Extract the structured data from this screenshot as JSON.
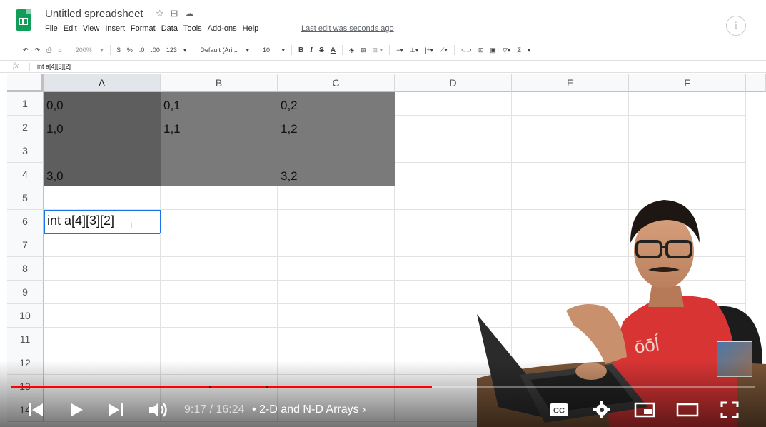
{
  "app": {
    "title": "Untitled spreadsheet",
    "title_icons": [
      "star-icon",
      "move-to-folder-icon",
      "cloud-status-icon"
    ],
    "menu": [
      "File",
      "Edit",
      "View",
      "Insert",
      "Format",
      "Data",
      "Tools",
      "Add-ons",
      "Help"
    ],
    "last_edit": "Last edit was seconds ago",
    "info_label": "i"
  },
  "toolbar": {
    "undo": "↶",
    "redo": "↷",
    "print": "⎙",
    "paint_format": "⌂",
    "zoom": "200%",
    "currency": "$",
    "percent": "%",
    "dec_decrease": ".0",
    "dec_increase": ".00",
    "more_formats": "123",
    "font": "Default (Ari...",
    "font_size": "10",
    "bold": "B",
    "italic": "I",
    "strike": "S",
    "text_color": "A",
    "sum": "Σ"
  },
  "formula_bar": {
    "fx": "fx",
    "value": "int a[4][3][2]"
  },
  "sheet": {
    "columns": [
      "A",
      "B",
      "C",
      "D",
      "E",
      "F"
    ],
    "selected_column": "A",
    "rows": [
      "1",
      "2",
      "3",
      "4",
      "5",
      "6",
      "7",
      "8",
      "9",
      "10",
      "11",
      "12",
      "13",
      "14"
    ],
    "cells": [
      [
        "0,0",
        "0,1",
        "0,2",
        "",
        "",
        ""
      ],
      [
        "1,0",
        "1,1",
        "1,2",
        "",
        "",
        ""
      ],
      [
        "",
        "",
        "",
        "",
        "",
        ""
      ],
      [
        "3,0",
        "",
        "3,2",
        "",
        "",
        ""
      ],
      [
        "",
        "",
        "",
        "",
        "",
        ""
      ],
      [
        "int a[4][3][2]",
        "",
        "",
        "",
        "",
        ""
      ]
    ],
    "active_cell": "A6"
  },
  "video": {
    "time": "9:17 / 16:24",
    "separator": "•",
    "chapter": "2-D and N-D Arrays",
    "chapter_chevron": "›",
    "played_fraction": 0.566,
    "chapter_marks_fraction": [
      0.266,
      0.343
    ],
    "accent": "#ff0000"
  },
  "colors": {
    "sheets_green": "#0f9d58",
    "selection_blue": "#1a73e8",
    "dark_fill": "#5e5e5e",
    "mid_fill": "#7a7a7a"
  }
}
